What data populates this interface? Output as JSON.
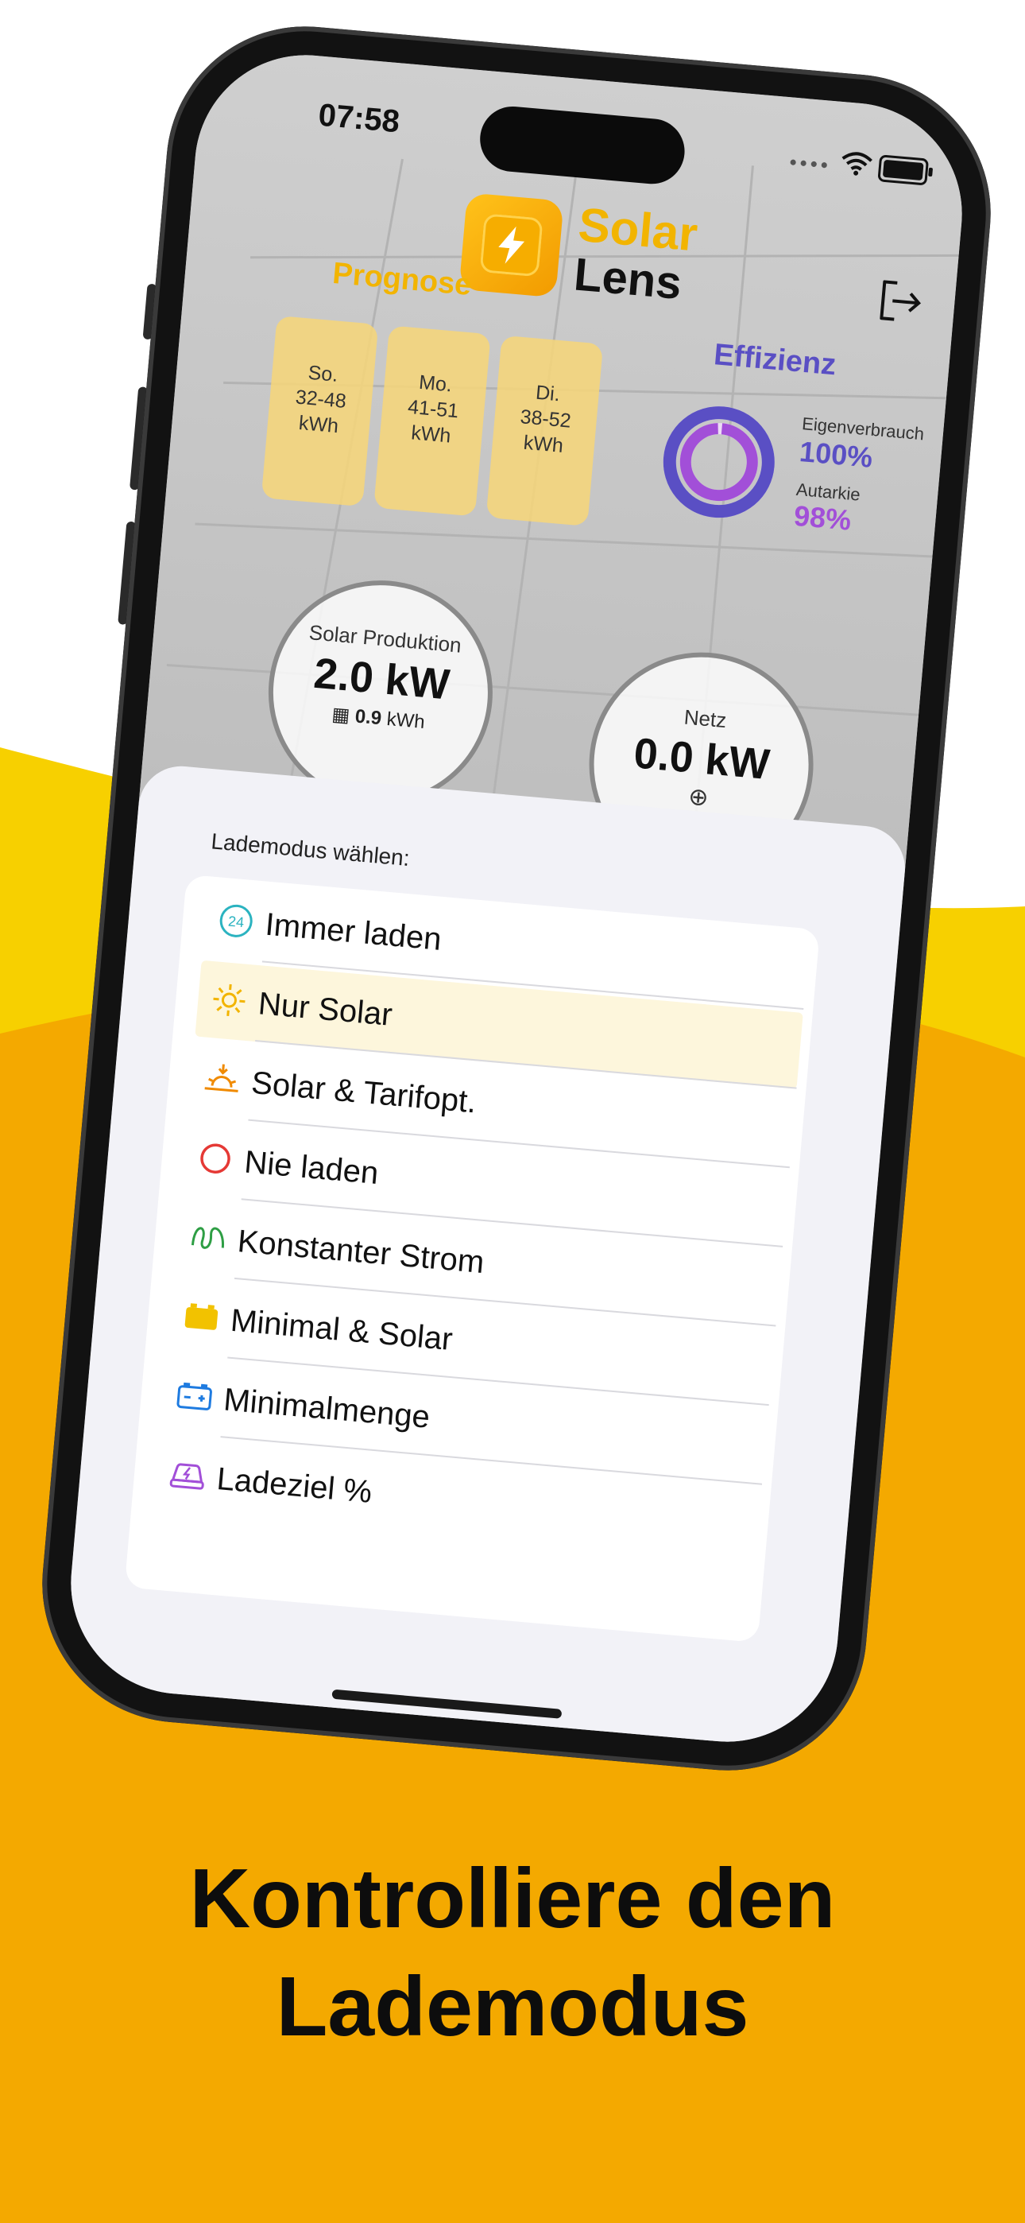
{
  "colors": {
    "accent_yellow": "#f2b400",
    "page_orange": "#f4a900",
    "wave_yellow": "#f7d000",
    "efficiency_purple": "#5a4fc4",
    "autarkie_purple": "#a24fd8"
  },
  "status_bar": {
    "time": "07:58",
    "signal": "••••"
  },
  "app": {
    "logo_line1": "Solar",
    "logo_line2": "Lens",
    "logout_icon": "logout-icon"
  },
  "forecast": {
    "title": "Prognose",
    "days": [
      {
        "day": "So.",
        "range": "32-48",
        "unit": "kWh"
      },
      {
        "day": "Mo.",
        "range": "41-51",
        "unit": "kWh"
      },
      {
        "day": "Di.",
        "range": "38-52",
        "unit": "kWh"
      }
    ]
  },
  "efficiency": {
    "title": "Effizienz",
    "self_consumption_label": "Eigenverbrauch",
    "self_consumption_value": "100%",
    "self_consumption_fraction": 1.0,
    "autarkie_label": "Autarkie",
    "autarkie_value": "98%",
    "autarkie_fraction": 0.98
  },
  "gauges": {
    "solar": {
      "label": "Solar Produktion",
      "value": "2.0 kW",
      "sub_value": "0.9",
      "sub_unit": "kWh"
    },
    "grid": {
      "label": "Netz",
      "value": "0.0 kW"
    }
  },
  "sheet": {
    "title": "Lademodus wählen:",
    "options": [
      {
        "label": "Immer laden",
        "icon": "clock-24-icon",
        "color": "#2bb3c0",
        "selected": false
      },
      {
        "label": "Nur Solar",
        "icon": "sun-icon",
        "color": "#f2b400",
        "selected": true
      },
      {
        "label": "Solar & Tarifopt.",
        "icon": "sunset-icon",
        "color": "#f08a00",
        "selected": false
      },
      {
        "label": "Nie laden",
        "icon": "circle-icon",
        "color": "#e53935",
        "selected": false
      },
      {
        "label": "Konstanter Strom",
        "icon": "coil-icon",
        "color": "#2e9e44",
        "selected": false
      },
      {
        "label": "Minimal & Solar",
        "icon": "battery-yellow-icon",
        "color": "#f2c200",
        "selected": false
      },
      {
        "label": "Minimalmenge",
        "icon": "battery-blue-icon",
        "color": "#1e7be0",
        "selected": false
      },
      {
        "label": "Ladeziel %",
        "icon": "car-charge-icon",
        "color": "#a24fd8",
        "selected": false
      }
    ]
  },
  "headline": {
    "line1": "Kontrolliere den",
    "line2": "Lademodus"
  }
}
